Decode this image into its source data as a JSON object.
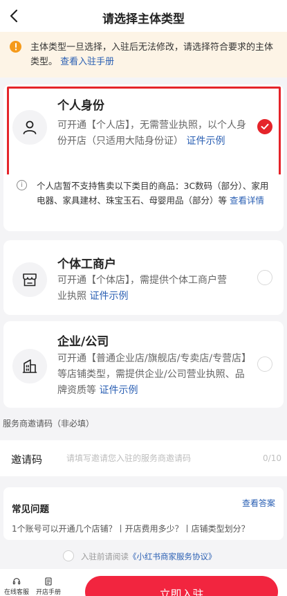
{
  "nav": {
    "back_icon": "chevron-left-icon",
    "title": "请选择主体类型"
  },
  "notice": {
    "icon": "exclamation-circle-icon",
    "text": "主体类型一旦选择，入驻后无法修改，请选择符合要求的主体类型。",
    "link": "查看入驻手册",
    "accent": "#f59a1b",
    "bg": "#fdf4e6"
  },
  "options": [
    {
      "icon": "person-icon",
      "title": "个人身份",
      "desc": "可开通【个人店】，无需营业执照，以个人身份开店（只适用大陆身份证）",
      "link": "证件示例",
      "selected": true
    },
    {
      "icon": "storefront-icon",
      "title": "个体工商户",
      "desc": "可开通【个体店】，需提供个体工商户营业执照",
      "link": "证件示例",
      "selected": false
    },
    {
      "icon": "building-icon",
      "title": "企业/公司",
      "desc": "可开通【普通企业店/旗舰店/专卖店/专营店】等店铺类型，需提供企业/公司营业执照、品牌资质等",
      "link": "证件示例",
      "selected": false
    }
  ],
  "warning": {
    "icon": "info-circle-icon",
    "text": "个人店暂不支持售卖以下类目的商品：3C数码（部分）、家用电器、家具建材、珠宝玉石、母婴用品（部分）等",
    "link": "查看详情"
  },
  "invite": {
    "section_label": "服务商邀请码（非必填）",
    "label": "邀请码",
    "placeholder": "请填写邀请您入驻的服务商邀请码",
    "value": "",
    "count": "0/10"
  },
  "faq": {
    "title": "常见问题",
    "more": "查看答案",
    "questions": "1个账号可以开通几个店铺？丨开店费用多少？丨店铺类型划分？"
  },
  "agreement": {
    "prefix": "入驻前请阅读",
    "link": "《小红书商家服务协议》",
    "checked": false
  },
  "bottom": {
    "tools": [
      {
        "icon": "headset-icon",
        "label": "在线客服"
      },
      {
        "icon": "document-icon",
        "label": "开店手册"
      }
    ],
    "submit": "立即入驻"
  },
  "colors": {
    "brand": "#f2253f",
    "selected_border": "#e5242a",
    "link": "#2a5fb3"
  }
}
